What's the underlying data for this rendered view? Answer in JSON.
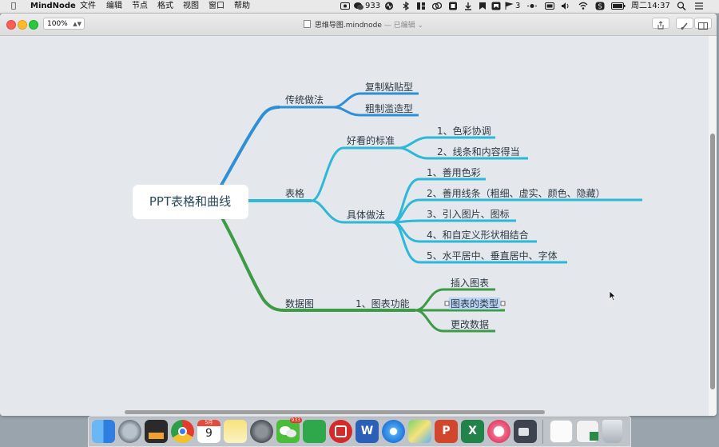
{
  "menubar": {
    "app_name": "MindNode",
    "menus": [
      "文件",
      "编辑",
      "节点",
      "格式",
      "视图",
      "窗口",
      "帮助"
    ],
    "wechat_count": "933",
    "extra_count": "3",
    "clock": "周二14:37",
    "status_icons": [
      "record-icon",
      "wechat-icon",
      "activity-icon",
      "bluetooth-icon",
      "layout-icon",
      "notes-icon",
      "flag-icon",
      "qq-icon",
      "display-icon",
      "wifi-icon",
      "volume-icon",
      "eye-icon",
      "scribe-icon",
      "battery-icon",
      "search-icon",
      "list-icon"
    ]
  },
  "window": {
    "zoom": "100%",
    "doc_name": "思维导图.mindnode",
    "doc_status": "— 已编辑 ⌄"
  },
  "mindmap": {
    "root": "PPT表格和曲线",
    "branches": [
      {
        "label": "传统做法",
        "color": "#2f8fd6",
        "children": [
          "复制粘贴型",
          "粗制滥造型"
        ]
      },
      {
        "label": "表格",
        "color": "#2cb8d6",
        "children": [
          {
            "label": "好看的标准",
            "children": [
              "1、色彩协调",
              "2、线条和内容得当"
            ]
          },
          {
            "label": "具体做法",
            "children": [
              "1、善用色彩",
              "2、善用线条（粗细、虚实、颜色、隐藏）",
              "3、引入图片、图标",
              "4、和自定义形状相结合",
              "5、水平居中、垂直居中、字体"
            ]
          }
        ]
      },
      {
        "label": "数据图",
        "color": "#3d9a46",
        "children": [
          {
            "label": "1、图表功能",
            "children": [
              "插入图表",
              "图表的类型",
              "更改数据"
            ]
          }
        ]
      }
    ],
    "selected": "图表的类型"
  },
  "dock": {
    "calendar_month": "5月",
    "calendar_day": "9",
    "wechat_badge": "933",
    "apps": [
      "finder-icon",
      "launchpad-icon",
      "activity-monitor-icon",
      "chrome-icon",
      "calendar-icon",
      "notes-icon",
      "system-preferences-icon",
      "wechat-icon",
      "evernote-icon",
      "bank-icon",
      "word-icon",
      "safari-icon",
      "maps-icon",
      "powerpoint-icon",
      "excel-icon",
      "music-icon",
      "video-icon",
      "airdrop-icon",
      "preview-icon",
      "trash-icon"
    ]
  }
}
